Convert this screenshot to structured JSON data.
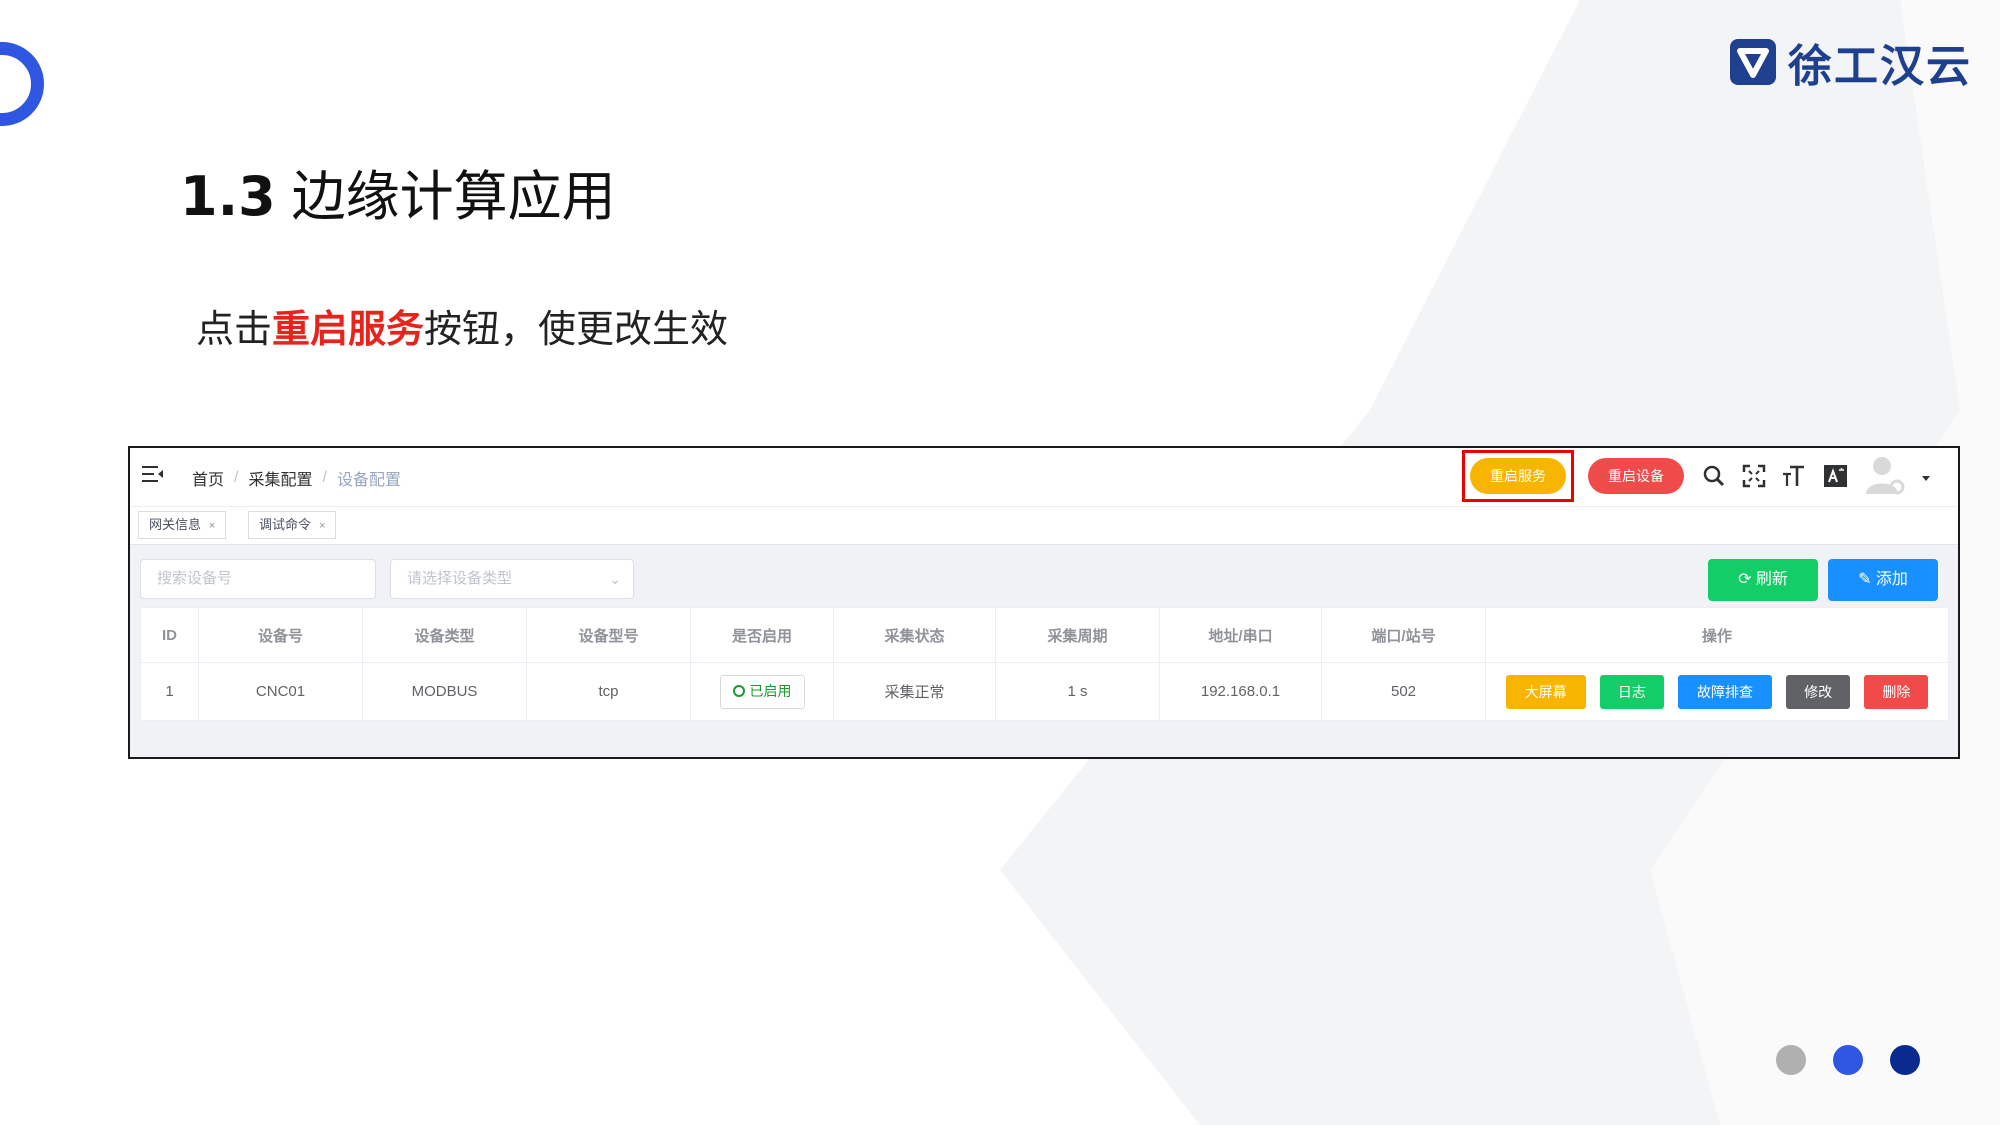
{
  "colors": {
    "accent_blue": "#2f56e0",
    "brand_navy": "#1f3f8f",
    "highlight_red": "#e8231c",
    "button_yellow": "#f7b500",
    "button_red": "#f04a4a",
    "button_green": "#13ce66",
    "button_blue": "#1890ff",
    "button_gray": "#606266",
    "dot_gray": "#b0b0b0",
    "dot_blue": "#2f56e0",
    "dot_navy": "#0b2a8f"
  },
  "brand": {
    "name": "徐工汉云",
    "icon": "brand-logo-icon"
  },
  "slide": {
    "title_number": "1.3",
    "title_text": "边缘计算应用",
    "subtitle_before": "点击",
    "subtitle_highlight": "重启服务",
    "subtitle_after": "按钮，使更改生效"
  },
  "app": {
    "breadcrumb": [
      "首页",
      "采集配置",
      "设备配置"
    ],
    "breadcrumb_separator": "/",
    "header_buttons": {
      "restart_service": "重启服务",
      "restart_device": "重启设备"
    },
    "header_icons": [
      "search-icon",
      "fullscreen-icon",
      "font-size-icon",
      "translate-icon",
      "user-avatar-icon",
      "caret-down-icon"
    ],
    "tags": [
      {
        "label": "网关信息",
        "close": "×"
      },
      {
        "label": "调试命令",
        "close": "×"
      }
    ],
    "filters": {
      "search_placeholder": "搜索设备号",
      "type_placeholder": "请选择设备类型"
    },
    "actions": {
      "refresh": "刷新",
      "add": "添加"
    },
    "table": {
      "columns": [
        "ID",
        "设备号",
        "设备类型",
        "设备型号",
        "是否启用",
        "采集状态",
        "采集周期",
        "地址/串口",
        "端口/站号",
        "操作"
      ],
      "rows": [
        {
          "id": "1",
          "device_no": "CNC01",
          "device_type": "MODBUS",
          "device_model": "tcp",
          "enabled": "已启用",
          "status": "采集正常",
          "period": "1 s",
          "address": "192.168.0.1",
          "port": "502",
          "ops": [
            "大屏幕",
            "日志",
            "故障排查",
            "修改",
            "删除"
          ]
        }
      ]
    }
  },
  "pagination_dots": [
    "gray",
    "blue",
    "navy"
  ]
}
